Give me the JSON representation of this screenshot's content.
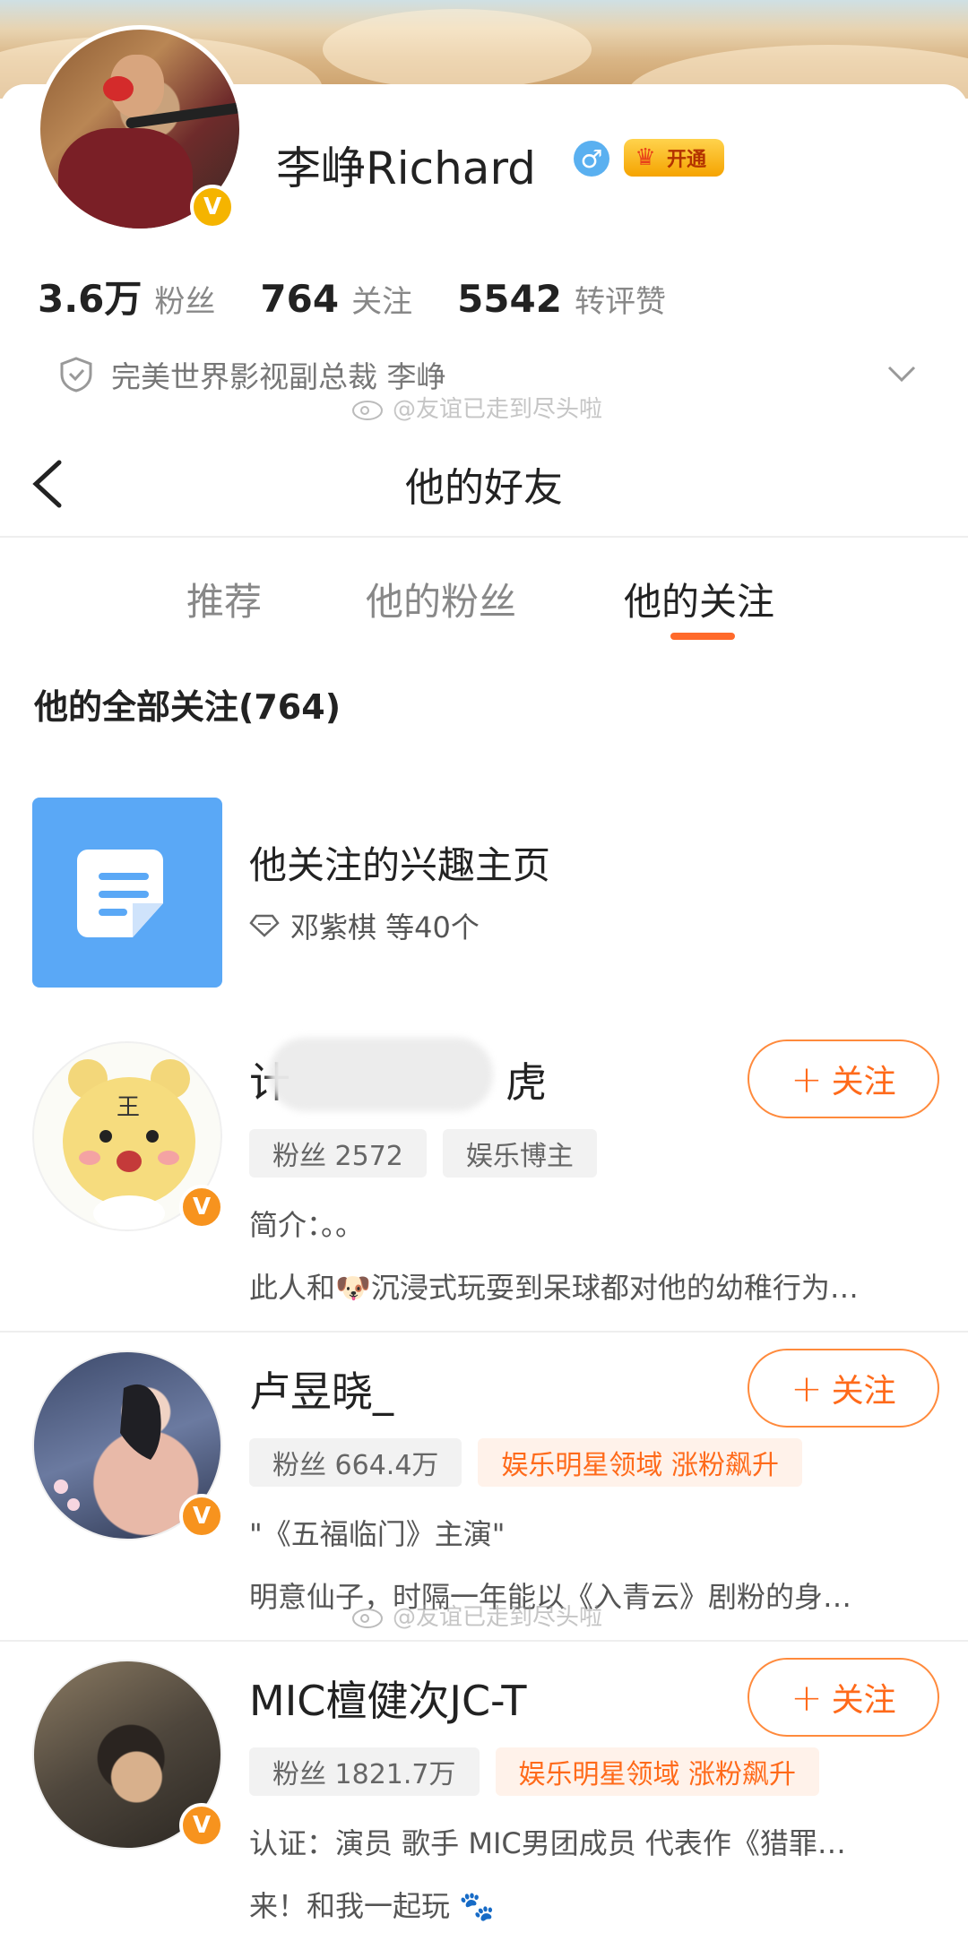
{
  "profile": {
    "name": "李峥Richard",
    "gender_symbol": "♂",
    "vip_label": "开通",
    "stats": [
      {
        "value": "3.6万",
        "label": "粉丝"
      },
      {
        "value": "764",
        "label": "关注"
      },
      {
        "value": "5542",
        "label": "转评赞"
      }
    ],
    "certification": "完美世界影视副总裁 李峥",
    "verified_mark": "V"
  },
  "watermark": "@友谊已走到尽头啦",
  "nav": {
    "title": "他的好友"
  },
  "tabs": [
    {
      "label": "推荐",
      "active": false
    },
    {
      "label": "他的粉丝",
      "active": false
    },
    {
      "label": "他的关注",
      "active": true
    }
  ],
  "accent_color": "#ff6a2b",
  "section_title": "他的全部关注(764)",
  "interest": {
    "title": "他关注的兴趣主页",
    "subtitle": "邓紫棋 等40个"
  },
  "follow_label": "关注",
  "users": [
    {
      "name_start": "计",
      "name_end": "虎",
      "tags": [
        {
          "text": "粉丝 2572",
          "hot": false
        },
        {
          "text": "娱乐博主",
          "hot": false
        }
      ],
      "line1": "简介：。。",
      "line2": "此人和🐶沉浸式玩耍到呆球都对他的幼稚行为…"
    },
    {
      "name": "卢昱晓_",
      "tags": [
        {
          "text": "粉丝 664.4万",
          "hot": false
        },
        {
          "text": "娱乐明星领域 涨粉飙升",
          "hot": true
        }
      ],
      "line1": "\"《五福临门》主演\"",
      "line2": "明意仙子，时隔一年能以《入青云》剧粉的身…"
    },
    {
      "name": "MIC檀健次JC-T",
      "tags": [
        {
          "text": "粉丝 1821.7万",
          "hot": false
        },
        {
          "text": "娱乐明星领域 涨粉飙升",
          "hot": true
        }
      ],
      "line1": "认证：演员 歌手 MIC男团成员 代表作《猎罪…",
      "line2": "来！和我一起玩"
    }
  ]
}
